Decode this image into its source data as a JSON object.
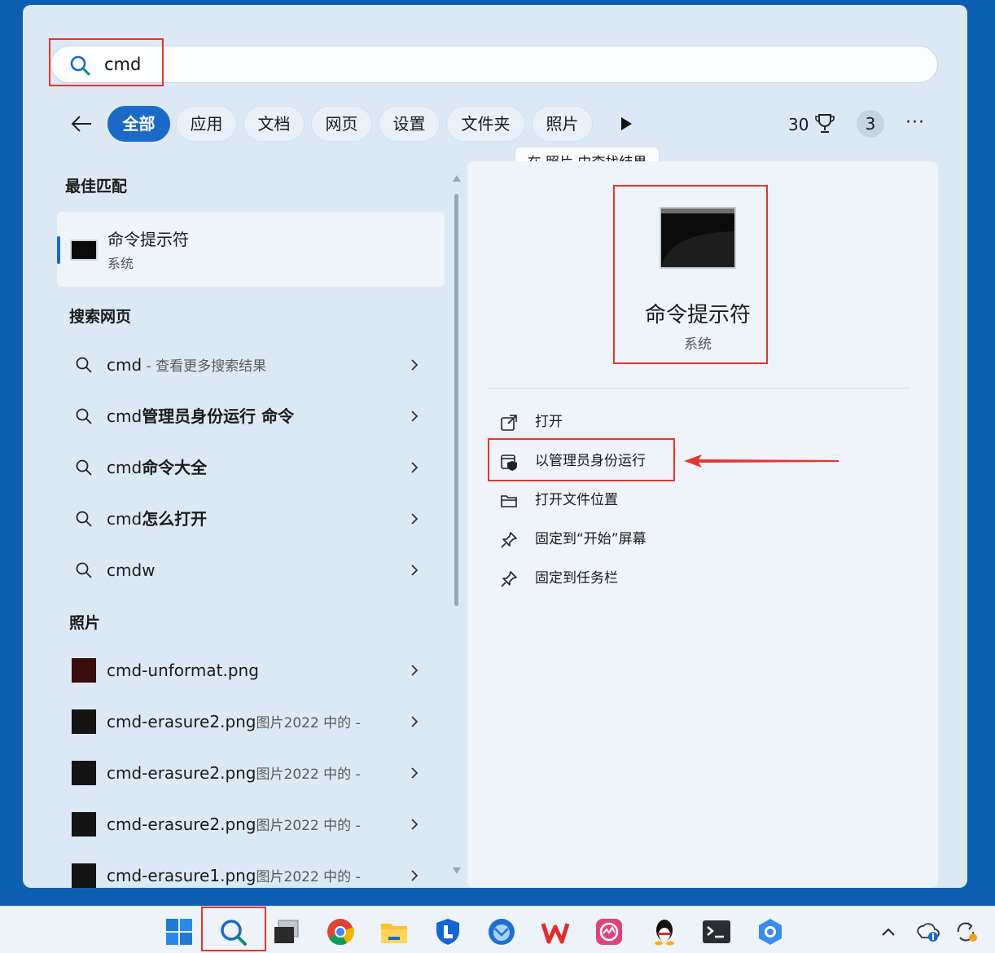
{
  "search": {
    "query": "cmd"
  },
  "tabs": [
    "全部",
    "应用",
    "文档",
    "网页",
    "设置",
    "文件夹",
    "照片"
  ],
  "header": {
    "points": "30",
    "badge": "3",
    "more": "···"
  },
  "tooltip": "在 照片 中查找结果",
  "best_match": {
    "section_title": "最佳匹配",
    "title": "命令提示符",
    "subtitle": "系统"
  },
  "web_search": {
    "section_title": "搜索网页",
    "items": [
      {
        "prefix": "cmd",
        "bold": "",
        "muted": " - 查看更多搜索结果"
      },
      {
        "prefix": "cmd",
        "bold": "管理员身份运行 命令",
        "muted": ""
      },
      {
        "prefix": "cmd",
        "bold": "命令大全",
        "muted": ""
      },
      {
        "prefix": "cmd",
        "bold": "怎么打开",
        "muted": ""
      },
      {
        "prefix": "cmdw",
        "bold": "",
        "muted": ""
      }
    ]
  },
  "photos": {
    "section_title": "照片",
    "items": [
      {
        "name": "cmd-unformat.png",
        "meta": ""
      },
      {
        "name": "cmd-erasure2.png",
        "meta": "图片2022 中的 -"
      },
      {
        "name": "cmd-erasure2.png",
        "meta": "图片2022 中的 -"
      },
      {
        "name": "cmd-erasure2.png",
        "meta": "图片2022 中的 -"
      },
      {
        "name": "cmd-erasure1.png",
        "meta": "图片2022 中的 -"
      }
    ]
  },
  "detail": {
    "title": "命令提示符",
    "subtitle": "系统",
    "actions": [
      {
        "label": "打开",
        "icon": "open-external-icon"
      },
      {
        "label": "以管理员身份运行",
        "icon": "admin-shield-icon"
      },
      {
        "label": "打开文件位置",
        "icon": "folder-icon"
      },
      {
        "label": "固定到“开始”屏幕",
        "icon": "pin-icon"
      },
      {
        "label": "固定到任务栏",
        "icon": "pin-icon"
      }
    ]
  },
  "colors": {
    "accent": "#1b6bc6",
    "highlight_red": "#e6362b",
    "panel": "#dce9f5",
    "desktop": "#0c5fb0"
  }
}
